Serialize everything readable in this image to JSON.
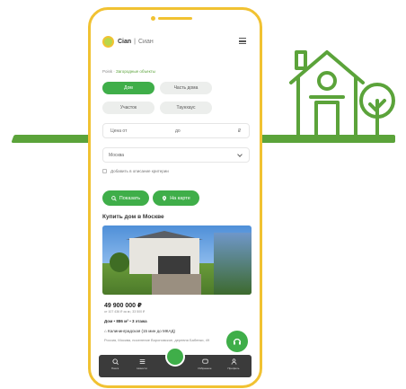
{
  "colors": {
    "brand_green": "#3fae49",
    "ground_green": "#5ba33a",
    "phone_frame": "#f1c232",
    "nav_bg": "#3b3b3b"
  },
  "header": {
    "logo_icon": "sun-logo-icon",
    "brand": "Cian",
    "separator": "|",
    "sub": "Сиан",
    "menu_icon": "hamburger-menu-icon"
  },
  "breadcrumb": {
    "items": [
      "Poisk",
      "Загородные объекты"
    ]
  },
  "property_types": [
    {
      "label": "Дом",
      "active": true
    },
    {
      "label": "Часть дома",
      "active": false
    },
    {
      "label": "Участок",
      "active": false
    },
    {
      "label": "Таунхаус",
      "active": false
    }
  ],
  "price_filter": {
    "from_label": "Цена от",
    "to_label": "до",
    "currency": "₽"
  },
  "location_select": {
    "value": "Москва"
  },
  "checkbox": {
    "label": "Добавить в описание критерии"
  },
  "actions": {
    "show_label": "Показать",
    "map_label": "На карте"
  },
  "section_title": "Купить дом в Москве",
  "listing": {
    "price": "49 900 000 ₽",
    "price_per_m2": "от 107 436 ₽ за м², 33 500 ₽",
    "specs": "Дом • 886 м² • 3 этажа",
    "metro": "Калининградская (15 мин до МКАД)",
    "address": "Россия, Москва, поселение Вороновское, деревня Бабенки, 49"
  },
  "bottom_nav": {
    "items": [
      {
        "icon": "search-icon",
        "label": "Поиск"
      },
      {
        "icon": "list-icon",
        "label": "Новости"
      },
      {
        "icon": "chat-icon",
        "label": "Избранное"
      },
      {
        "icon": "profile-icon",
        "label": "Профиль"
      }
    ]
  }
}
